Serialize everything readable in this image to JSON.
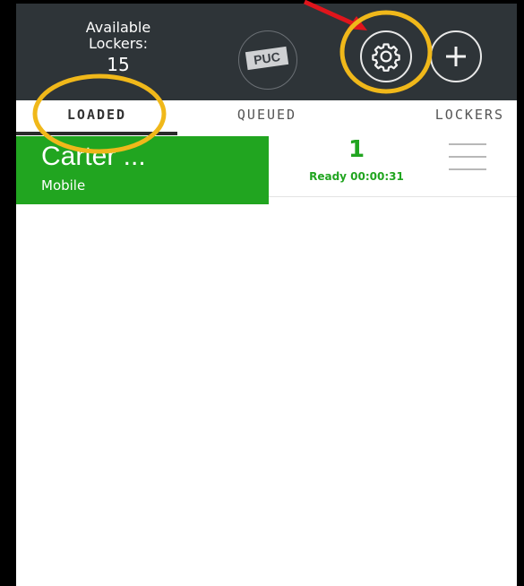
{
  "header": {
    "available_label": "Available Lockers:",
    "available_count": "15",
    "logo_text": "PUC"
  },
  "tabs": [
    {
      "label": "LOADED",
      "active": true
    },
    {
      "label": "QUEUED",
      "active": false
    },
    {
      "label": "LOCKERS",
      "active": false
    }
  ],
  "list": {
    "items": [
      {
        "name": "Carter ...",
        "type": "Mobile",
        "count": "1",
        "status": "Ready 00:00:31"
      }
    ]
  },
  "icons": {
    "settings": "gear-icon",
    "add": "plus-icon",
    "menu": "hamburger-menu-icon"
  },
  "colors": {
    "topbar": "#2e3438",
    "accent_green": "#21a520",
    "highlight_circle": "#f0b81a",
    "arrow": "#e0151c"
  }
}
